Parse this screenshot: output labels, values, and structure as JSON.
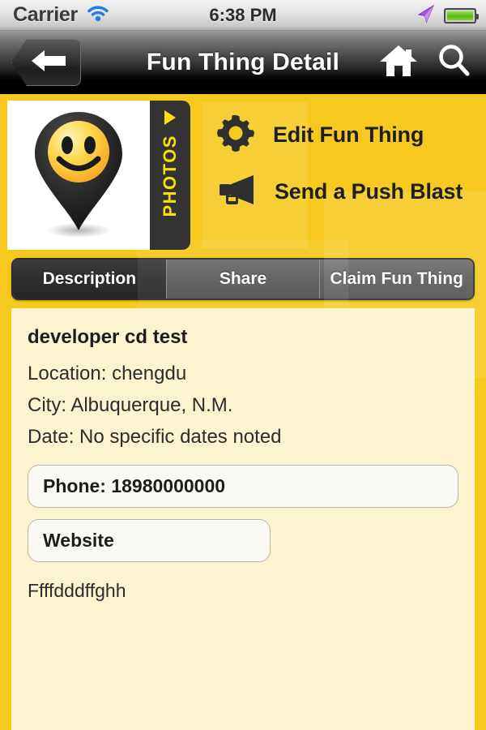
{
  "status_bar": {
    "carrier": "Carrier",
    "wifi_icon": "wifi-icon",
    "time": "6:38 PM",
    "location_icon": "location-arrow-icon",
    "battery_icon": "battery-icon",
    "battery_color": "#5cba16"
  },
  "nav_bar": {
    "back_icon": "back-arrow-icon",
    "title": "Fun Thing Detail",
    "home_icon": "home-icon",
    "search_icon": "search-icon"
  },
  "hero": {
    "thumbnail_icon": "map-pin-smiley-icon",
    "photos_tab_label": "PHOTOS",
    "photos_tab_arrow_icon": "play-triangle-icon",
    "actions": [
      {
        "icon": "gear-icon",
        "label": "Edit Fun Thing"
      },
      {
        "icon": "megaphone-icon",
        "label": "Send a Push Blast"
      }
    ]
  },
  "tabs": [
    {
      "label": "Description",
      "active": true
    },
    {
      "label": "Share",
      "active": false
    },
    {
      "label": "Claim Fun Thing",
      "active": false
    }
  ],
  "detail": {
    "title": "developer cd test",
    "lines": [
      "Location: chengdu",
      "City: Albuquerque, N.M.",
      "Date: No specific dates noted"
    ],
    "phone_field": "Phone: 18980000000",
    "website_field": "Website",
    "description": "Ffffdddffghh"
  },
  "theme": {
    "brand_yellow": "#F5C91E",
    "panel_cream": "#FBF4CE",
    "accent_yellow": "#F9E300",
    "dark": "#2e2e2e"
  }
}
